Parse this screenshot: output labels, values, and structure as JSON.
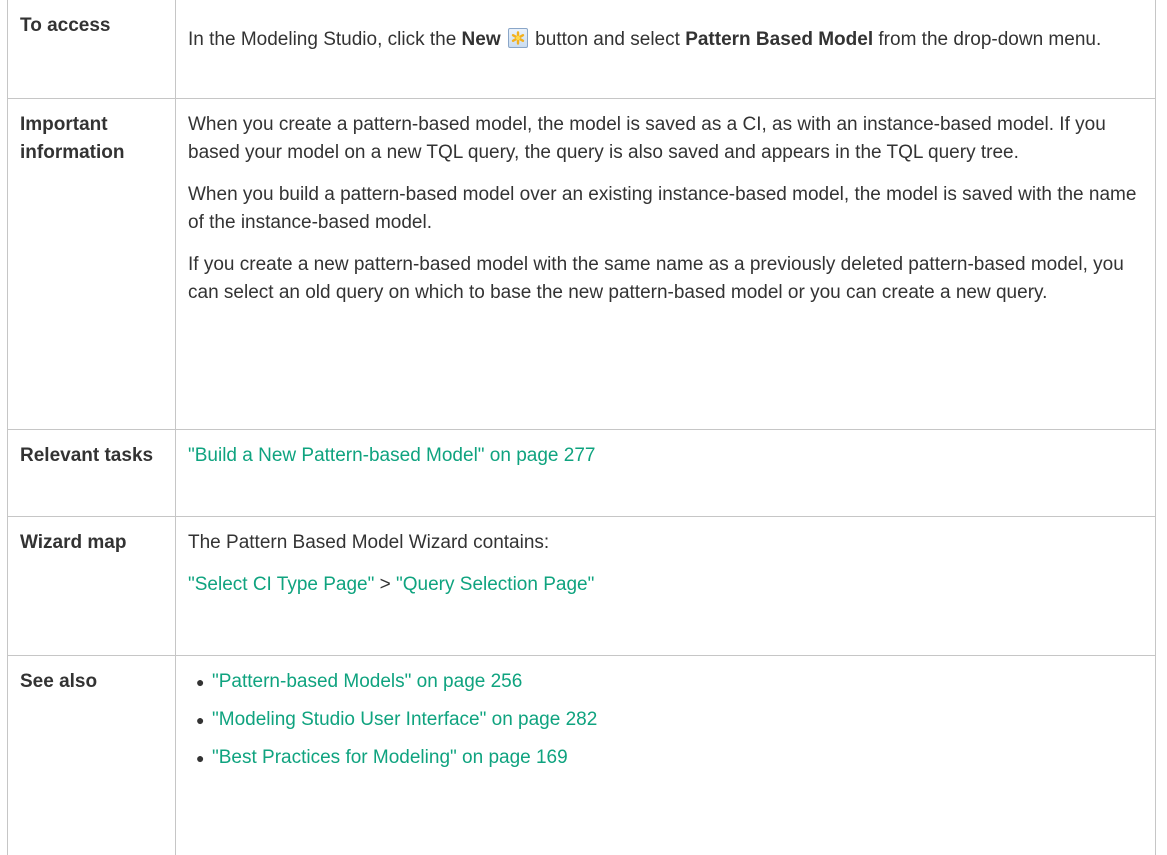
{
  "access": {
    "label": "To access",
    "text_before": "In the Modeling Studio, click the ",
    "new_button": "New",
    "text_middle": " button and select ",
    "menu_item": "Pattern Based Model",
    "text_after": " from the drop-down menu.",
    "icon": "new-star-icon"
  },
  "important": {
    "label": "Important information",
    "paragraphs": [
      "When you create a pattern-based model, the model is saved as a CI, as with an instance-based model. If you based your model on a new TQL query, the query is also saved and appears in the TQL query tree.",
      "When you build a pattern-based model over an existing instance-based model, the model is saved with the name of the instance-based model.",
      "If you create a new pattern-based model with the same name as a previously deleted pattern-based model, you can select an old query on which to base the new pattern-based model or you can create a new query."
    ]
  },
  "tasks": {
    "label": "Relevant tasks",
    "link": "\"Build a New Pattern-based Model\" on page 277"
  },
  "wizard": {
    "label": "Wizard map",
    "intro": "The Pattern Based Model Wizard contains:",
    "step1": "\"Select CI Type Page\"",
    "separator": " > ",
    "step2": "\"Query Selection Page\""
  },
  "see_also": {
    "label": "See also",
    "items": [
      "\"Pattern-based Models\" on page 256",
      "\"Modeling Studio User Interface\" on page 282",
      "\"Best Practices for Modeling\" on page 169"
    ]
  },
  "colors": {
    "link": "#0fa37f",
    "border": "#c6c6c6",
    "text": "#333333"
  }
}
